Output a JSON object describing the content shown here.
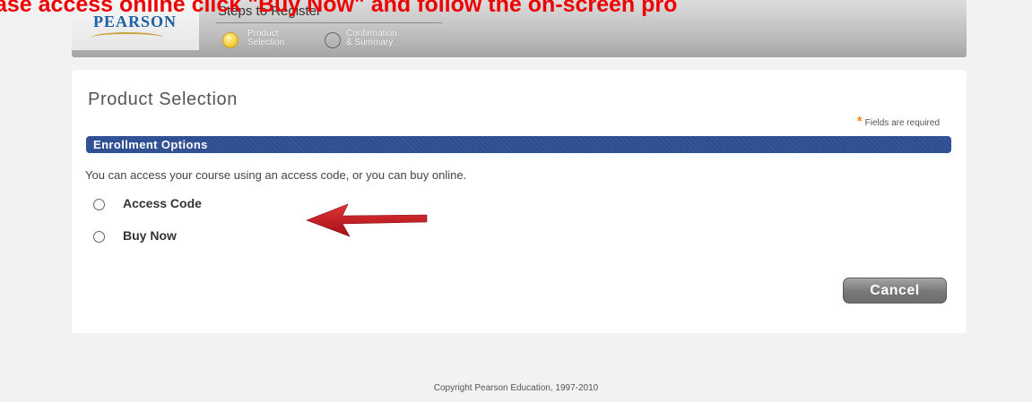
{
  "banner": {
    "text": "ase access online click \"Buy Now\" and follow the on-screen pro"
  },
  "header": {
    "logo": "PEARSON",
    "steps_title": "Steps to Register",
    "steps": [
      {
        "label": "Product Selection",
        "active": true
      },
      {
        "label": "Confirmation & Summary",
        "active": false
      }
    ]
  },
  "main": {
    "title": "Product Selection",
    "required_note": "Fields are required",
    "section_title": "Enrollment Options",
    "description": "You can access your course using an access code, or you can buy online.",
    "options": [
      {
        "label": "Access Code",
        "selected": false
      },
      {
        "label": "Buy Now",
        "selected": false
      }
    ],
    "cancel_label": "Cancel"
  },
  "footer": {
    "copyright": "Copyright Pearson Education, 1997-2010"
  },
  "colors": {
    "banner": "#ee0000",
    "section_bar": "#2d4d8f",
    "active_step": "#f2cd37",
    "required_star": "#f28c1b",
    "arrow": "#c0151b"
  },
  "icons": [
    "radio-button-icon",
    "arrow-pointer-icon",
    "step-indicator-icon"
  ]
}
